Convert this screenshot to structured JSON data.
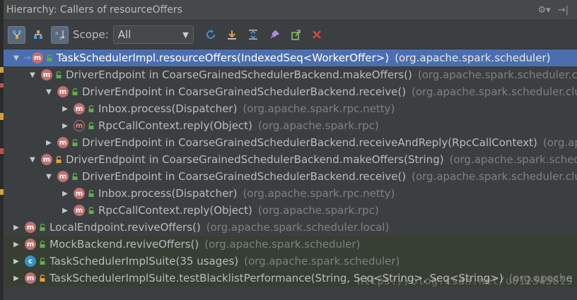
{
  "title": "Hierarchy: Callers of resourceOffers",
  "toolbar": {
    "scope_label": "Scope:",
    "scope_value": "All"
  },
  "colors": {
    "selection": "#4b6eaf",
    "method_badge": "#c0706e",
    "class_badge": "#3592c4",
    "lock_green": "#5fae4a",
    "lock_orange": "#e3a23b",
    "refresh": "#3d8fdb",
    "close": "#e0443c"
  },
  "tree": [
    {
      "toggle": "▼",
      "badge": "m",
      "lock": "green",
      "name": "TaskSchedulerImpl.resourceOffers(IndexedSeq<WorkerOffer>)",
      "pkg": "(org.apache.spark.scheduler)"
    },
    {
      "toggle": "▼",
      "badge": "m",
      "lock": "green",
      "name": "DriverEndpoint in CoarseGrainedSchedulerBackend.makeOffers()",
      "pkg": "(org.apache.spark.scheduler.clus"
    },
    {
      "toggle": "▼",
      "badge": "m",
      "lock": "green",
      "name": "DriverEndpoint in CoarseGrainedSchedulerBackend.receive()",
      "pkg": "(org.apache.spark.scheduler.clust"
    },
    {
      "toggle": "▶",
      "badge": "m",
      "lock": "green",
      "name": "Inbox.process(Dispatcher)",
      "pkg": "(org.apache.spark.rpc.netty)"
    },
    {
      "toggle": "▶",
      "badge": "m",
      "lock": "green",
      "name": "RpcCallContext.reply(Object)",
      "pkg": "(org.apache.spark.rpc)"
    },
    {
      "toggle": "▶",
      "badge": "m",
      "lock": "green",
      "name": "DriverEndpoint in CoarseGrainedSchedulerBackend.receiveAndReply(RpcCallContext)",
      "pkg": "(org.apa"
    },
    {
      "toggle": "▼",
      "badge": "m",
      "lock": "orange",
      "name": "DriverEndpoint in CoarseGrainedSchedulerBackend.makeOffers(String)",
      "pkg": "(org.apache.spark.schedul"
    },
    {
      "toggle": "▼",
      "badge": "m",
      "lock": "green",
      "name": "DriverEndpoint in CoarseGrainedSchedulerBackend.receive()",
      "pkg": "(org.apache.spark.scheduler.clust"
    },
    {
      "toggle": "▶",
      "badge": "m",
      "lock": "green",
      "name": "Inbox.process(Dispatcher)",
      "pkg": "(org.apache.spark.rpc.netty)"
    },
    {
      "toggle": "▶",
      "badge": "m",
      "lock": "green",
      "name": "RpcCallContext.reply(Object)",
      "pkg": "(org.apache.spark.rpc)"
    },
    {
      "toggle": "▶",
      "badge": "m",
      "lock": "green",
      "name": "LocalEndpoint.reviveOffers()",
      "pkg": "(org.apache.spark.scheduler.local)"
    },
    {
      "toggle": "▶",
      "badge": "m",
      "lock": "green",
      "name": "MockBackend.reviveOffers()",
      "pkg": "(org.apache.spark.scheduler)"
    },
    {
      "toggle": "▶",
      "badge": "c",
      "lock": "green",
      "name": "TaskSchedulerImplSuite(35 usages)",
      "pkg": "(org.apache.spark.scheduler)"
    },
    {
      "toggle": "▶",
      "badge": "m",
      "lock": "orange",
      "name": "TaskSchedulerImplSuite.testBlacklistPerformance(String, Seq<String>, Seq<String>)",
      "pkg": "(org.apache"
    }
  ],
  "watermark": "https://blog.csdn.net/u012545819"
}
